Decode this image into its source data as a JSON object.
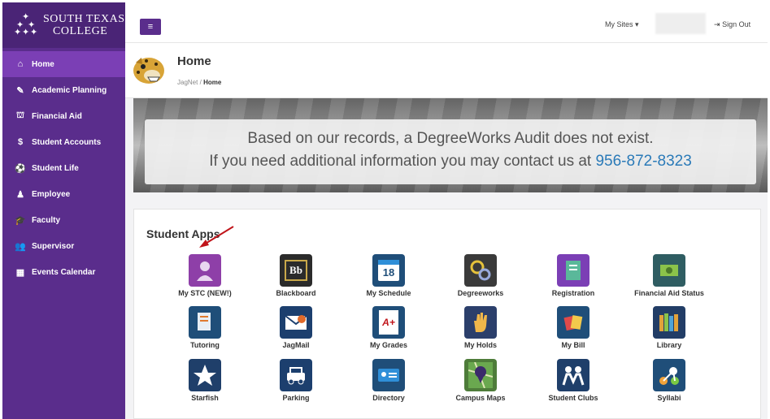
{
  "logo": {
    "line1": "SOUTH TEXAS",
    "line2": "COLLEGE"
  },
  "sidebar": {
    "items": [
      {
        "label": "Home",
        "icon": "home-icon"
      },
      {
        "label": "Academic Planning",
        "icon": "pencil-icon"
      },
      {
        "label": "Financial Aid",
        "icon": "bank-icon"
      },
      {
        "label": "Student Accounts",
        "icon": "dollar-icon"
      },
      {
        "label": "Student Life",
        "icon": "soccer-ball-icon"
      },
      {
        "label": "Employee",
        "icon": "person-icon"
      },
      {
        "label": "Faculty",
        "icon": "graduation-cap-icon"
      },
      {
        "label": "Supervisor",
        "icon": "group-icon"
      },
      {
        "label": "Events Calendar",
        "icon": "calendar-icon"
      }
    ]
  },
  "topbar": {
    "menu_glyph": "≡",
    "my_sites": "My Sites",
    "sign_out": "Sign Out"
  },
  "header": {
    "title": "Home",
    "crumb_root": "JagNet",
    "crumb_sep": "/",
    "crumb_current": "Home"
  },
  "banner": {
    "line1": "Based on our records, a DegreeWorks Audit does not exist.",
    "line2_prefix": "If you need additional information you may contact us at",
    "phone": "956-872-8323"
  },
  "apps": {
    "title": "Student Apps",
    "items": [
      {
        "label": "My STC (NEW!)",
        "icon": "person-silhouette-icon",
        "color": "#8e3fa8"
      },
      {
        "label": "Blackboard",
        "icon": "blackboard-icon",
        "color": "#2b2b2b",
        "glyph": "Bb"
      },
      {
        "label": "My Schedule",
        "icon": "calendar-icon",
        "color": "#1f4e79",
        "glyph": "18"
      },
      {
        "label": "Degreeworks",
        "icon": "gears-icon",
        "color": "#3a3a3a"
      },
      {
        "label": "Registration",
        "icon": "clipboard-icon",
        "color": "#7b3fb5"
      },
      {
        "label": "Financial Aid Status",
        "icon": "money-icon",
        "color": "#2f5d62"
      },
      {
        "label": "Tutoring",
        "icon": "notebook-icon",
        "color": "#1f4e79"
      },
      {
        "label": "JagMail",
        "icon": "envelope-icon",
        "color": "#1c3f6e"
      },
      {
        "label": "My Grades",
        "icon": "grade-paper-icon",
        "color": "#1f4e79",
        "glyph": "A+"
      },
      {
        "label": "My Holds",
        "icon": "hand-icon",
        "color": "#2b3f6b"
      },
      {
        "label": "My Bill",
        "icon": "bill-icon",
        "color": "#1f4e79"
      },
      {
        "label": "Library",
        "icon": "books-icon",
        "color": "#223d66"
      },
      {
        "label": "Starfish",
        "icon": "starfish-icon",
        "color": "#1f3f6a"
      },
      {
        "label": "Parking",
        "icon": "car-icon",
        "color": "#1c3f6e"
      },
      {
        "label": "Directory",
        "icon": "id-card-icon",
        "color": "#1f4e79"
      },
      {
        "label": "Campus Maps",
        "icon": "map-pin-icon",
        "color": "#4e7c3a"
      },
      {
        "label": "Student Clubs",
        "icon": "people-icon",
        "color": "#1f3f6a"
      },
      {
        "label": "Syllabi",
        "icon": "syllabi-icon",
        "color": "#1f4e79"
      }
    ]
  }
}
